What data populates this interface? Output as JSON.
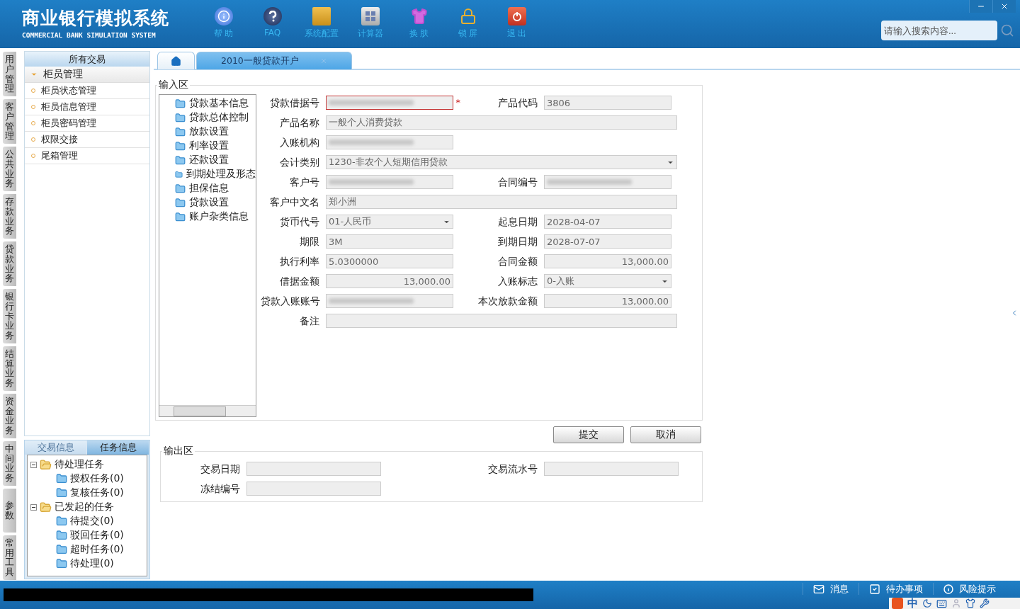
{
  "header": {
    "title": "商业银行模拟系统",
    "subtitle": "COMMERCIAL BANK SIMULATION SYSTEM",
    "tools": [
      {
        "kind": "info",
        "label": "帮 助"
      },
      {
        "kind": "faq",
        "label": "FAQ"
      },
      {
        "kind": "config",
        "label": "系统配置"
      },
      {
        "kind": "calc",
        "label": "计算器"
      },
      {
        "kind": "skin",
        "label": "换 肤"
      },
      {
        "kind": "lock",
        "label": "锁 屏"
      },
      {
        "kind": "exit",
        "label": "退 出"
      }
    ],
    "search": {
      "placeholder": "请输入搜索内容..."
    }
  },
  "side_tabs": [
    "用户管理",
    "客户管理",
    "公共业务",
    "存款业务",
    "贷款业务",
    "银行卡业务",
    "结算业务",
    "资金业务",
    "中间业务",
    "参数",
    "常用工具"
  ],
  "sidebar": {
    "title": "所有交易",
    "group": {
      "label": "柜员管理",
      "expanded": true,
      "items": [
        "柜员状态管理",
        "柜员信息管理",
        "柜员密码管理",
        "权限交接",
        "尾箱管理"
      ]
    }
  },
  "task_panel": {
    "tabs": [
      {
        "label": "交易信息",
        "selected": false
      },
      {
        "label": "任务信息",
        "selected": true
      }
    ],
    "tree": [
      {
        "label": "待处理任务",
        "expanded": true,
        "children": [
          {
            "label": "授权任务(0)"
          },
          {
            "label": "复核任务(0)"
          }
        ]
      },
      {
        "label": "已发起的任务",
        "expanded": true,
        "children": [
          {
            "label": "待提交(0)"
          },
          {
            "label": "驳回任务(0)"
          },
          {
            "label": "超时任务(0)"
          },
          {
            "label": "待处理(0)"
          }
        ]
      }
    ]
  },
  "tabs": [
    {
      "kind": "home",
      "selected": false
    },
    {
      "kind": "page",
      "label": "2010一般贷款开户",
      "selected": true
    }
  ],
  "input_area": {
    "title": "输入区",
    "nav": [
      "贷款基本信息",
      "贷款总体控制",
      "放款设置",
      "利率设置",
      "还款设置",
      "到期处理及形态",
      "担保信息",
      "贷款设置",
      "账户杂类信息"
    ],
    "rows": [
      [
        {
          "label": "贷款借据号",
          "kind": "text",
          "redacted": true,
          "required_mark": "*",
          "invalid": true
        },
        {
          "label": "产品代码",
          "kind": "text",
          "value": "3806"
        }
      ],
      [
        {
          "label": "产品名称",
          "kind": "text",
          "value": "一般个人消费贷款",
          "wide": true
        }
      ],
      [
        {
          "label": "入账机构",
          "kind": "text",
          "redacted": true
        }
      ],
      [
        {
          "label": "会计类别",
          "kind": "select",
          "value": "1230-非农个人短期信用贷款",
          "wide": true
        }
      ],
      [
        {
          "label": "客户号",
          "kind": "text",
          "redacted": true
        },
        {
          "label": "合同编号",
          "kind": "text",
          "redacted": true
        }
      ],
      [
        {
          "label": "客户中文名",
          "kind": "text",
          "value": "郑小洲",
          "wide": true
        }
      ],
      [
        {
          "label": "货币代号",
          "kind": "select",
          "value": "01-人民币"
        },
        {
          "label": "起息日期",
          "kind": "text",
          "value": "2028-04-07"
        }
      ],
      [
        {
          "label": "期限",
          "kind": "text",
          "value": "3M"
        },
        {
          "label": "到期日期",
          "kind": "text",
          "value": "2028-07-07"
        }
      ],
      [
        {
          "label": "执行利率",
          "kind": "text",
          "value": "5.0300000"
        },
        {
          "label": "合同金额",
          "kind": "amount",
          "value": "13,000.00"
        }
      ],
      [
        {
          "label": "借据金额",
          "kind": "amount",
          "value": "13,000.00"
        },
        {
          "label": "入账标志",
          "kind": "select",
          "value": "0-入账"
        }
      ],
      [
        {
          "label": "贷款入账账号",
          "kind": "text",
          "redacted": true
        },
        {
          "label": "本次放款金额",
          "kind": "amount",
          "value": "13,000.00"
        }
      ],
      [
        {
          "label": "备注",
          "kind": "text",
          "wide": true
        }
      ]
    ]
  },
  "buttons": [
    "提交",
    "取消"
  ],
  "output_area": {
    "title": "输出区",
    "rows": [
      [
        {
          "label": "交易日期"
        },
        {
          "label": "交易流水号"
        }
      ],
      [
        {
          "label": "冻结编号"
        }
      ]
    ]
  },
  "status_bar": {
    "items": [
      {
        "kind": "mail",
        "label": "消息"
      },
      {
        "kind": "todo",
        "label": "待办事项"
      },
      {
        "kind": "alert",
        "label": "风险提示"
      }
    ]
  },
  "ime_toolbar": {
    "label": "中"
  }
}
